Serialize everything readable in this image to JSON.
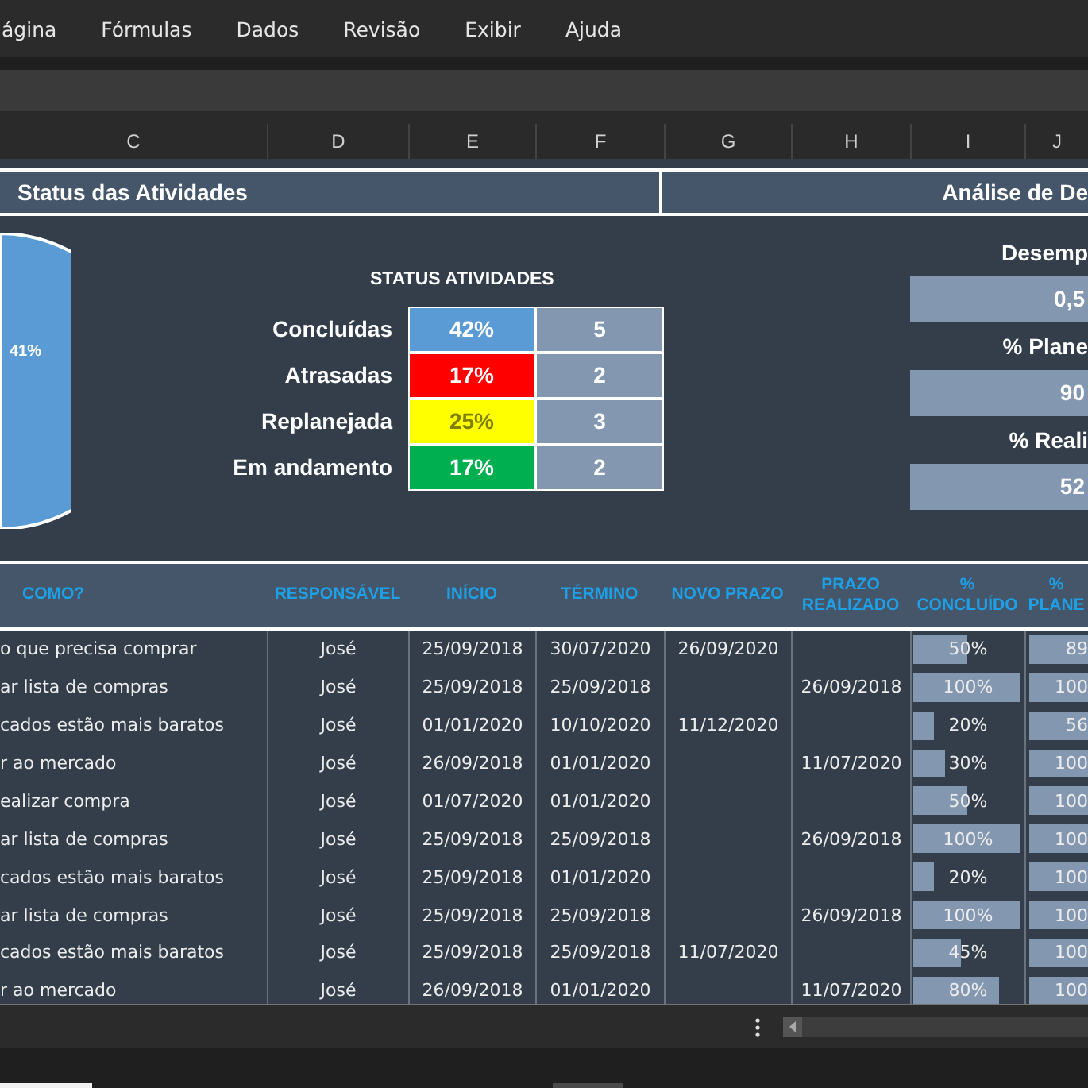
{
  "menu": [
    "ágina",
    "Fórmulas",
    "Dados",
    "Revisão",
    "Exibir",
    "Ajuda"
  ],
  "column_headers": [
    "C",
    "D",
    "E",
    "F",
    "G",
    "H",
    "I",
    "J"
  ],
  "sections": [
    "Status das Atividades",
    "Análise de De"
  ],
  "pie": {
    "label": "41%"
  },
  "status": {
    "title": "STATUS ATIVIDADES",
    "items": [
      {
        "label": "Concluídas",
        "percent": "42%",
        "count": "5",
        "color": "#5b9bd5"
      },
      {
        "label": "Atrasadas",
        "percent": "17%",
        "count": "2",
        "color": "#ff0000"
      },
      {
        "label": "Replanejada",
        "percent": "25%",
        "count": "3",
        "color": "#ffff00"
      },
      {
        "label": "Em andamento",
        "percent": "17%",
        "count": "2",
        "color": "#00b050"
      }
    ]
  },
  "analysis": [
    {
      "label": "Desemp",
      "value": "0,5"
    },
    {
      "label": "% Plane",
      "value": "90"
    },
    {
      "label": "% Reali",
      "value": "52"
    }
  ],
  "table": {
    "columns": [
      "COMO?",
      "RESPONSÁVEL",
      "INÍCIO",
      "TÉRMINO",
      "NOVO PRAZO",
      "PRAZO REALIZADO",
      "% CONCLUÍDO",
      "% PLANE"
    ],
    "rows": [
      {
        "como": "o que precisa comprar",
        "resp": "José",
        "inicio": "25/09/2018",
        "termino": "30/07/2020",
        "novo": "26/09/2020",
        "realizado": "",
        "concluido": {
          "text": "50%",
          "level": 0.5
        },
        "planejado": "89"
      },
      {
        "como": "ar lista de compras",
        "resp": "José",
        "inicio": "25/09/2018",
        "termino": "25/09/2018",
        "novo": "",
        "realizado": "26/09/2018",
        "concluido": {
          "text": "100%",
          "level": 1
        },
        "planejado": "100"
      },
      {
        "como": "cados estão mais baratos",
        "resp": "José",
        "inicio": "01/01/2020",
        "termino": "10/10/2020",
        "novo": "11/12/2020",
        "realizado": "",
        "concluido": {
          "text": "20%",
          "level": 0.2
        },
        "planejado": "56"
      },
      {
        "como": "r ao mercado",
        "resp": "José",
        "inicio": "26/09/2018",
        "termino": "01/01/2020",
        "novo": "",
        "realizado": "11/07/2020",
        "concluido": {
          "text": "30%",
          "level": 0.3
        },
        "planejado": "100"
      },
      {
        "como": "ealizar compra",
        "resp": "José",
        "inicio": "01/07/2020",
        "termino": "01/01/2020",
        "novo": "",
        "realizado": "",
        "concluido": {
          "text": "50%",
          "level": 0.5
        },
        "planejado": "100"
      },
      {
        "como": "ar lista de compras",
        "resp": "José",
        "inicio": "25/09/2018",
        "termino": "25/09/2018",
        "novo": "",
        "realizado": "26/09/2018",
        "concluido": {
          "text": "100%",
          "level": 1
        },
        "planejado": "100"
      },
      {
        "como": "cados estão mais baratos",
        "resp": "José",
        "inicio": "25/09/2018",
        "termino": "01/01/2020",
        "novo": "",
        "realizado": "",
        "concluido": {
          "text": "20%",
          "level": 0.2
        },
        "planejado": "100"
      },
      {
        "como": "ar lista de compras",
        "resp": "José",
        "inicio": "25/09/2018",
        "termino": "25/09/2018",
        "novo": "",
        "realizado": "26/09/2018",
        "concluido": {
          "text": "100%",
          "level": 1
        },
        "planejado": "100"
      },
      {
        "como": "cados estão mais baratos",
        "resp": "José",
        "inicio": "25/09/2018",
        "termino": "25/09/2018",
        "novo": "11/07/2020",
        "realizado": "",
        "concluido": {
          "text": "45%",
          "level": 0.45
        },
        "planejado": "100"
      },
      {
        "como": "r ao mercado",
        "resp": "José",
        "inicio": "26/09/2018",
        "termino": "01/01/2020",
        "novo": "",
        "realizado": "11/07/2020",
        "concluido": {
          "text": "80%",
          "level": 0.8
        },
        "planejado": "100"
      }
    ]
  }
}
